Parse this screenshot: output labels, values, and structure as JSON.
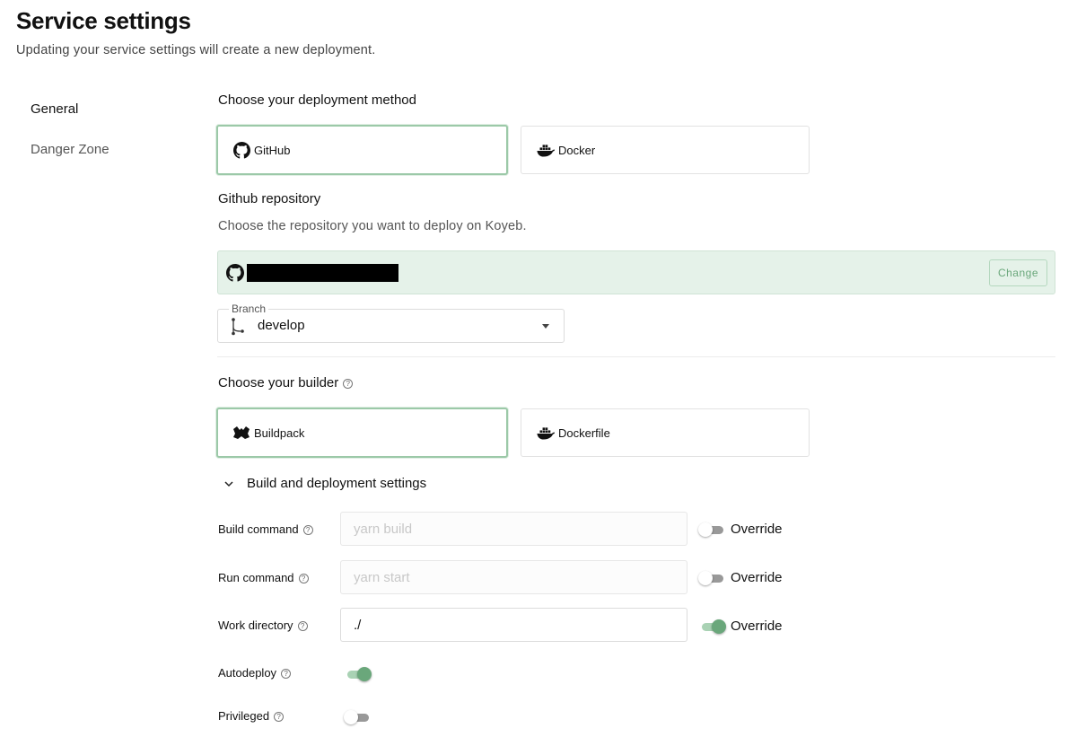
{
  "page": {
    "title": "Service settings",
    "subtitle": "Updating your service settings will create a new deployment."
  },
  "sidebar": {
    "items": [
      {
        "label": "General",
        "active": true
      },
      {
        "label": "Danger Zone",
        "active": false
      }
    ]
  },
  "deployment_method": {
    "title": "Choose your deployment method",
    "options": [
      {
        "label": "GitHub",
        "icon": "github-icon",
        "selected": true
      },
      {
        "label": "Docker",
        "icon": "docker-icon",
        "selected": false
      }
    ]
  },
  "repository": {
    "title": "Github repository",
    "description": "Choose the repository you want to deploy on Koyeb.",
    "name": "[redacted]",
    "change_label": "Change"
  },
  "branch": {
    "legend": "Branch",
    "value": "develop"
  },
  "builder": {
    "title": "Choose your builder",
    "options": [
      {
        "label": "Buildpack",
        "icon": "buildpack-icon",
        "selected": true
      },
      {
        "label": "Dockerfile",
        "icon": "docker-icon",
        "selected": false
      }
    ]
  },
  "build_settings": {
    "title": "Build and deployment settings",
    "expanded": true,
    "override_label": "Override",
    "fields": [
      {
        "label": "Build command",
        "value": "",
        "placeholder": "yarn build",
        "override": false
      },
      {
        "label": "Run command",
        "value": "",
        "placeholder": "yarn start",
        "override": false
      },
      {
        "label": "Work directory",
        "value": "./",
        "placeholder": "",
        "override": true
      }
    ],
    "autodeploy": {
      "label": "Autodeploy",
      "enabled": true
    },
    "privileged": {
      "label": "Privileged",
      "enabled": false
    }
  },
  "colors": {
    "accent_green": "#6aa77b",
    "selected_border": "#9cc9a8",
    "repo_bar_bg": "#e5f2e9"
  }
}
